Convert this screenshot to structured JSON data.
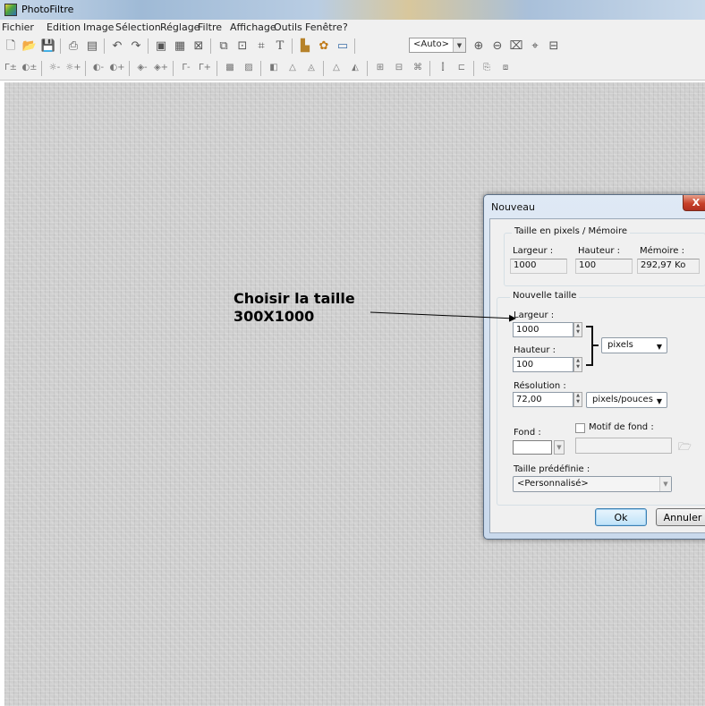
{
  "app": {
    "title": "PhotoFiltre"
  },
  "menu": [
    "Fichier",
    "Edition",
    "Image",
    "Sélection",
    "Réglage",
    "Filtre",
    "Affichage",
    "Outils",
    "Fenêtre",
    "?"
  ],
  "toolbar": {
    "zoom_value": "<Auto>"
  },
  "annotation": {
    "line1": "Choisir la taille",
    "line2": "300X1000"
  },
  "dialog": {
    "title": "Nouveau",
    "close_label": "X",
    "memory_group": {
      "legend": "Taille en pixels / Mémoire",
      "width_label": "Largeur :",
      "height_label": "Hauteur :",
      "memory_label": "Mémoire :",
      "width_value": "1000",
      "height_value": "100",
      "memory_value": "292,97 Ko"
    },
    "size_group": {
      "legend": "Nouvelle taille",
      "width_label": "Largeur :",
      "width_value": "1000",
      "height_label": "Hauteur :",
      "height_value": "100",
      "unit_value": "pixels",
      "resolution_label": "Résolution :",
      "resolution_value": "72,00",
      "resolution_unit": "pixels/pouces",
      "background_label": "Fond :",
      "pattern_label": "Motif de fond :",
      "preset_label": "Taille prédéfinie :",
      "preset_value": "<Personnalisé>"
    },
    "ok_label": "Ok",
    "cancel_label": "Annuler"
  },
  "colors": {
    "background_swatch": "#ffffff",
    "default_button_border": "#3c7fb1",
    "close_button": "#c7412a"
  }
}
